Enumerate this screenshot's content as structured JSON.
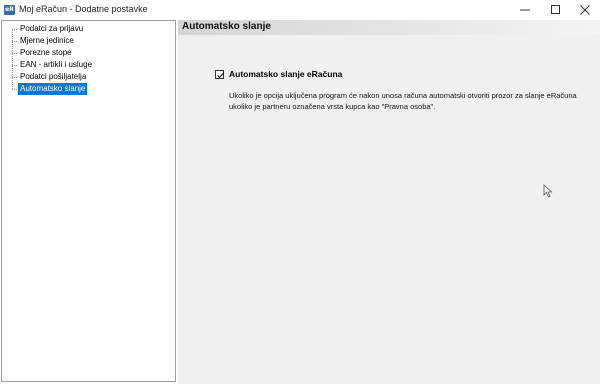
{
  "window": {
    "icon_text": "eR",
    "title": "Moj eRačun - Dodatne postavke"
  },
  "tree": {
    "items": [
      {
        "label": "Podatci za prijavu",
        "selected": false
      },
      {
        "label": "Mjerne jedinice",
        "selected": false
      },
      {
        "label": "Porezne stope",
        "selected": false
      },
      {
        "label": "EAN - artikli i usluge",
        "selected": false
      },
      {
        "label": "Podatci pošiljatelja",
        "selected": false
      },
      {
        "label": "Automatsko slanje",
        "selected": true
      }
    ]
  },
  "panel": {
    "title": "Automatsko slanje",
    "checkbox_label": "Automatsko slanje eRačuna",
    "checkbox_checked": true,
    "description": "Ukoliko je opcija uključena program će nakon unosa računa automatski otvoriti prozor za slanje eRačuna ukoliko je partneru označena vrsta kupca kao \"Pravna osoba\"."
  },
  "colors": {
    "selection": "#0078d7",
    "panel_background": "#f0f0f0"
  }
}
